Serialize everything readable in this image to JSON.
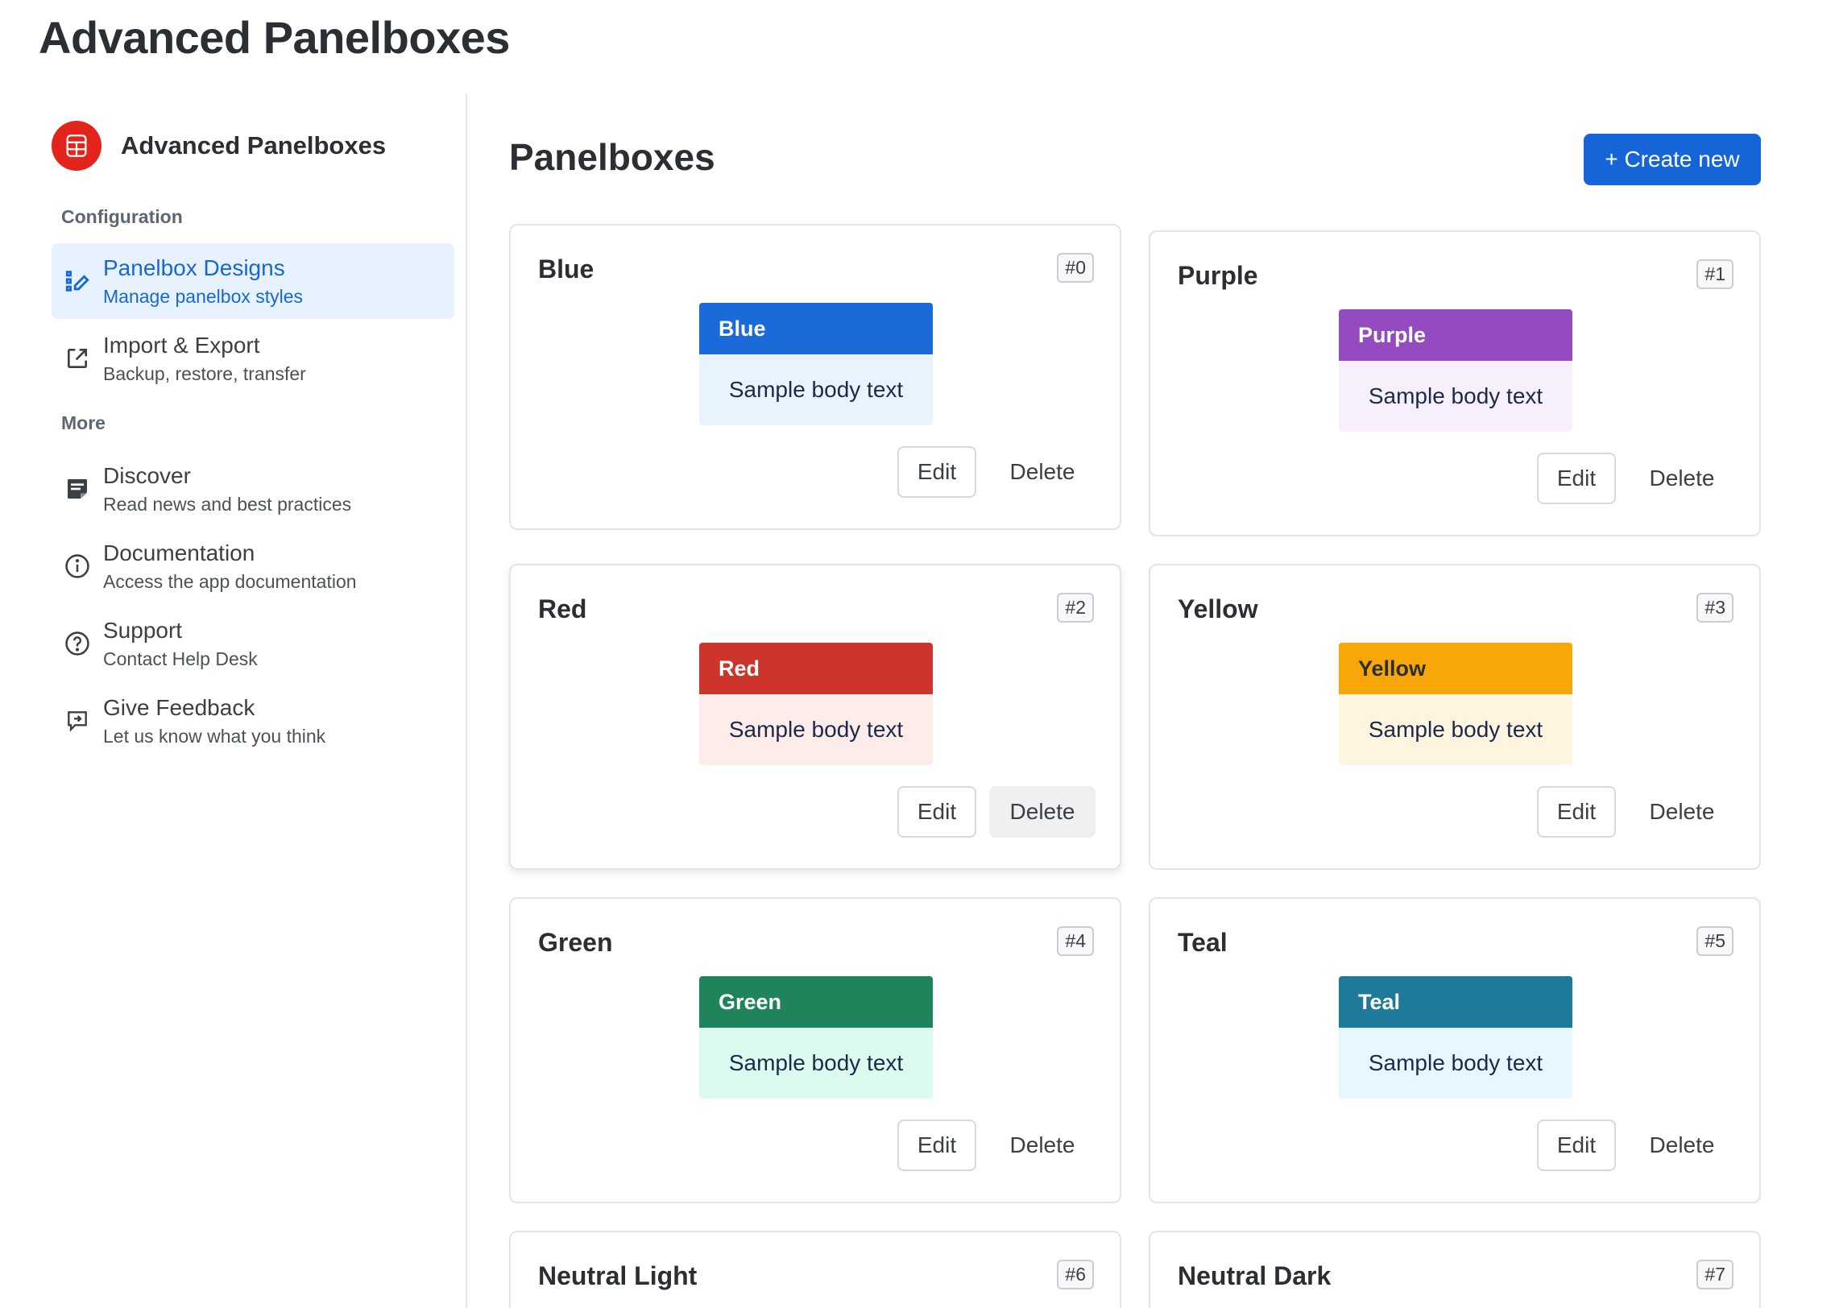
{
  "page": {
    "title": "Advanced Panelboxes"
  },
  "sidebar": {
    "brand": {
      "name": "Advanced Panelboxes",
      "logo_icon": "panelbox-logo-icon",
      "logo_color": "#e2241b"
    },
    "sections": [
      {
        "label": "Configuration",
        "items": [
          {
            "title": "Panelbox Designs",
            "subtitle": "Manage panelbox styles",
            "icon": "design-edit-icon",
            "active": true
          },
          {
            "title": "Import & Export",
            "subtitle": "Backup, restore, transfer",
            "icon": "external-link-icon",
            "active": false
          }
        ]
      },
      {
        "label": "More",
        "items": [
          {
            "title": "Discover",
            "subtitle": "Read news and best practices",
            "icon": "news-icon",
            "active": false
          },
          {
            "title": "Documentation",
            "subtitle": "Access the app documentation",
            "icon": "info-icon",
            "active": false
          },
          {
            "title": "Support",
            "subtitle": "Contact Help Desk",
            "icon": "help-icon",
            "active": false
          },
          {
            "title": "Give Feedback",
            "subtitle": "Let us know what you think",
            "icon": "feedback-icon",
            "active": false
          }
        ]
      }
    ]
  },
  "main": {
    "title": "Panelboxes",
    "create_label": "+ Create new",
    "edit_label": "Edit",
    "delete_label": "Delete",
    "panelboxes": [
      {
        "name": "Blue",
        "id": "#0",
        "preview_title": "Blue",
        "preview_body": "Sample body text",
        "header_color": "#1a6ad9",
        "body_color": "#e9f3fe",
        "header_text_color": "#ffffff"
      },
      {
        "name": "Purple",
        "id": "#1",
        "preview_title": "Purple",
        "preview_body": "Sample body text",
        "header_color": "#944bbf",
        "body_color": "#f8effd",
        "header_text_color": "#ffffff"
      },
      {
        "name": "Red",
        "id": "#2",
        "preview_title": "Red",
        "preview_body": "Sample body text",
        "header_color": "#cd352c",
        "body_color": "#feeceb",
        "header_text_color": "#ffffff"
      },
      {
        "name": "Yellow",
        "id": "#3",
        "preview_title": "Yellow",
        "preview_body": "Sample body text",
        "header_color": "#f8a608",
        "body_color": "#fef5e0",
        "header_text_color": "#2b2f33"
      },
      {
        "name": "Green",
        "id": "#4",
        "preview_title": "Green",
        "preview_body": "Sample body text",
        "header_color": "#20845a",
        "body_color": "#dcfbee",
        "header_text_color": "#ffffff"
      },
      {
        "name": "Teal",
        "id": "#5",
        "preview_title": "Teal",
        "preview_body": "Sample body text",
        "header_color": "#1e7a99",
        "body_color": "#e6f8fe",
        "header_text_color": "#ffffff"
      },
      {
        "name": "Neutral Light",
        "id": "#6",
        "preview_title": "",
        "preview_body": "",
        "header_color": "#eef0f2",
        "body_color": "#f7f8f9",
        "header_text_color": "#2b2f33"
      },
      {
        "name": "Neutral Dark",
        "id": "#7",
        "preview_title": "",
        "preview_body": "",
        "header_color": "#2b2f33",
        "body_color": "#f1f2f4",
        "header_text_color": "#ffffff"
      }
    ]
  }
}
